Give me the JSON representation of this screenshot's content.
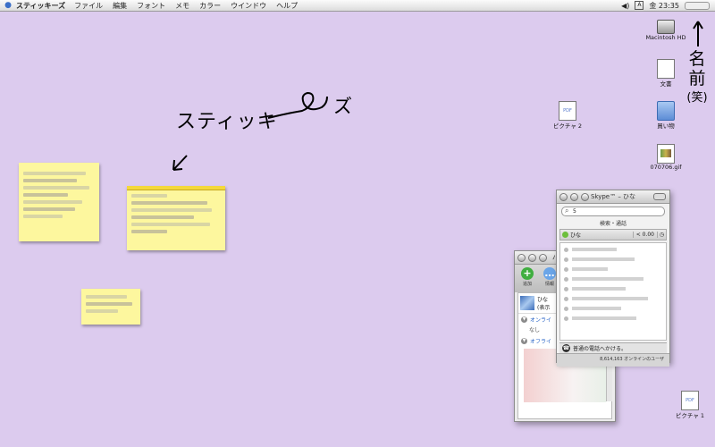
{
  "menubar": {
    "app_name": "スティッキーズ",
    "items": [
      "ファイル",
      "編集",
      "フォント",
      "メモ",
      "カラー",
      "ウインドウ",
      "ヘルプ"
    ],
    "volume_icon": "speaker-icon",
    "clock": "金 23:35"
  },
  "desktop_icons": [
    {
      "label": "Macintosh HD",
      "icon": "hard-disk-icon"
    },
    {
      "label": "文書",
      "icon": "document-icon"
    },
    {
      "label": "ピクチャ 2",
      "icon": "pdf-icon"
    },
    {
      "label": "買い物",
      "icon": "folder-icon"
    },
    {
      "label": "070706.gif",
      "icon": "image-file-icon"
    },
    {
      "label": "ピクチャ 1",
      "icon": "pdf-icon"
    }
  ],
  "annotations": {
    "stickies": "スティッキ",
    "zu": "ズ",
    "name_lines": [
      "名",
      "前",
      "(笑)"
    ]
  },
  "skype": {
    "title": "Skype™ – ひな",
    "search_value": "5",
    "tabs_label": "検索・通話",
    "my_name": "ひな",
    "credit": "< 0.00",
    "call_label": "普通の電話へかける。",
    "footer": "8,614,163 オンラインのユーザ"
  },
  "buddy": {
    "title": "バ",
    "toolbar_add": "追加",
    "toolbar_info": "情報",
    "my_name": "ひな",
    "my_status": "(表示",
    "group_online": "オンライ",
    "group_online_empty": "なし",
    "group_offline": "オフライ"
  }
}
